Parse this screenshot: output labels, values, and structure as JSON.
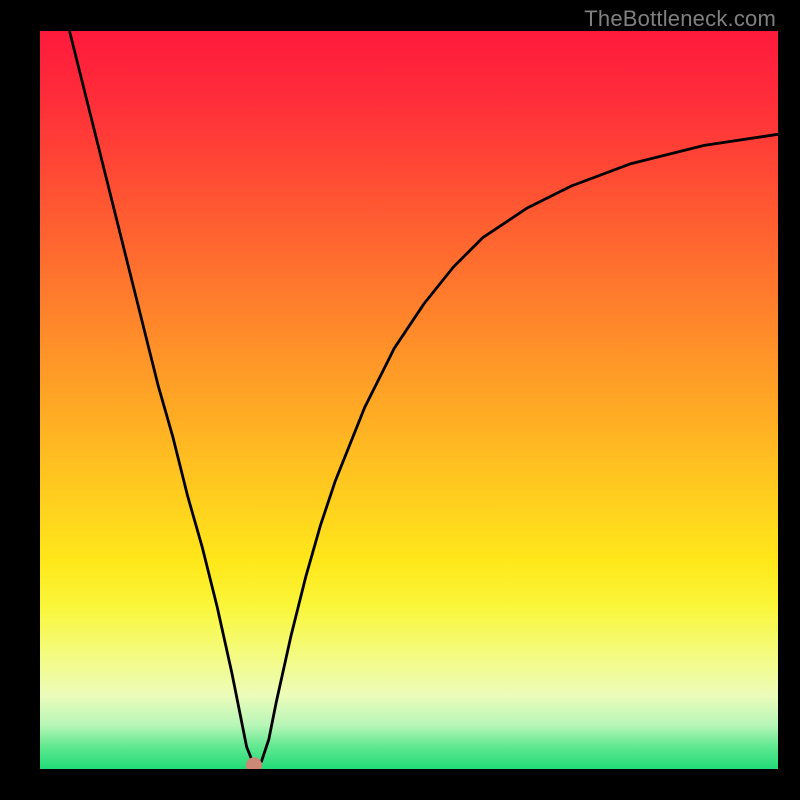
{
  "watermark": "TheBottleneck.com",
  "chart_data": {
    "type": "line",
    "title": "",
    "xlabel": "",
    "ylabel": "",
    "xlim": [
      0,
      100
    ],
    "ylim": [
      0,
      100
    ],
    "x": [
      4,
      6,
      8,
      10,
      12,
      14,
      16,
      18,
      20,
      22,
      24,
      26,
      27,
      28,
      29,
      30,
      31,
      32,
      34,
      36,
      38,
      40,
      44,
      48,
      52,
      56,
      60,
      66,
      72,
      80,
      90,
      100
    ],
    "y": [
      100,
      92,
      84,
      76,
      68,
      60,
      52,
      45,
      37,
      30,
      22,
      13,
      8,
      3,
      0.5,
      1,
      4,
      9,
      18,
      26,
      33,
      39,
      49,
      57,
      63,
      68,
      72,
      76,
      79,
      82,
      84.5,
      86
    ],
    "marker_point": {
      "x": 29,
      "y": 0.5
    },
    "gradient_stops": [
      {
        "pos": 0.0,
        "color": "#ff1a3c"
      },
      {
        "pos": 0.4,
        "color": "#ff882a"
      },
      {
        "pos": 0.72,
        "color": "#ffe81a"
      },
      {
        "pos": 0.9,
        "color": "#ecfcba"
      },
      {
        "pos": 1.0,
        "color": "#20dc78"
      }
    ]
  }
}
